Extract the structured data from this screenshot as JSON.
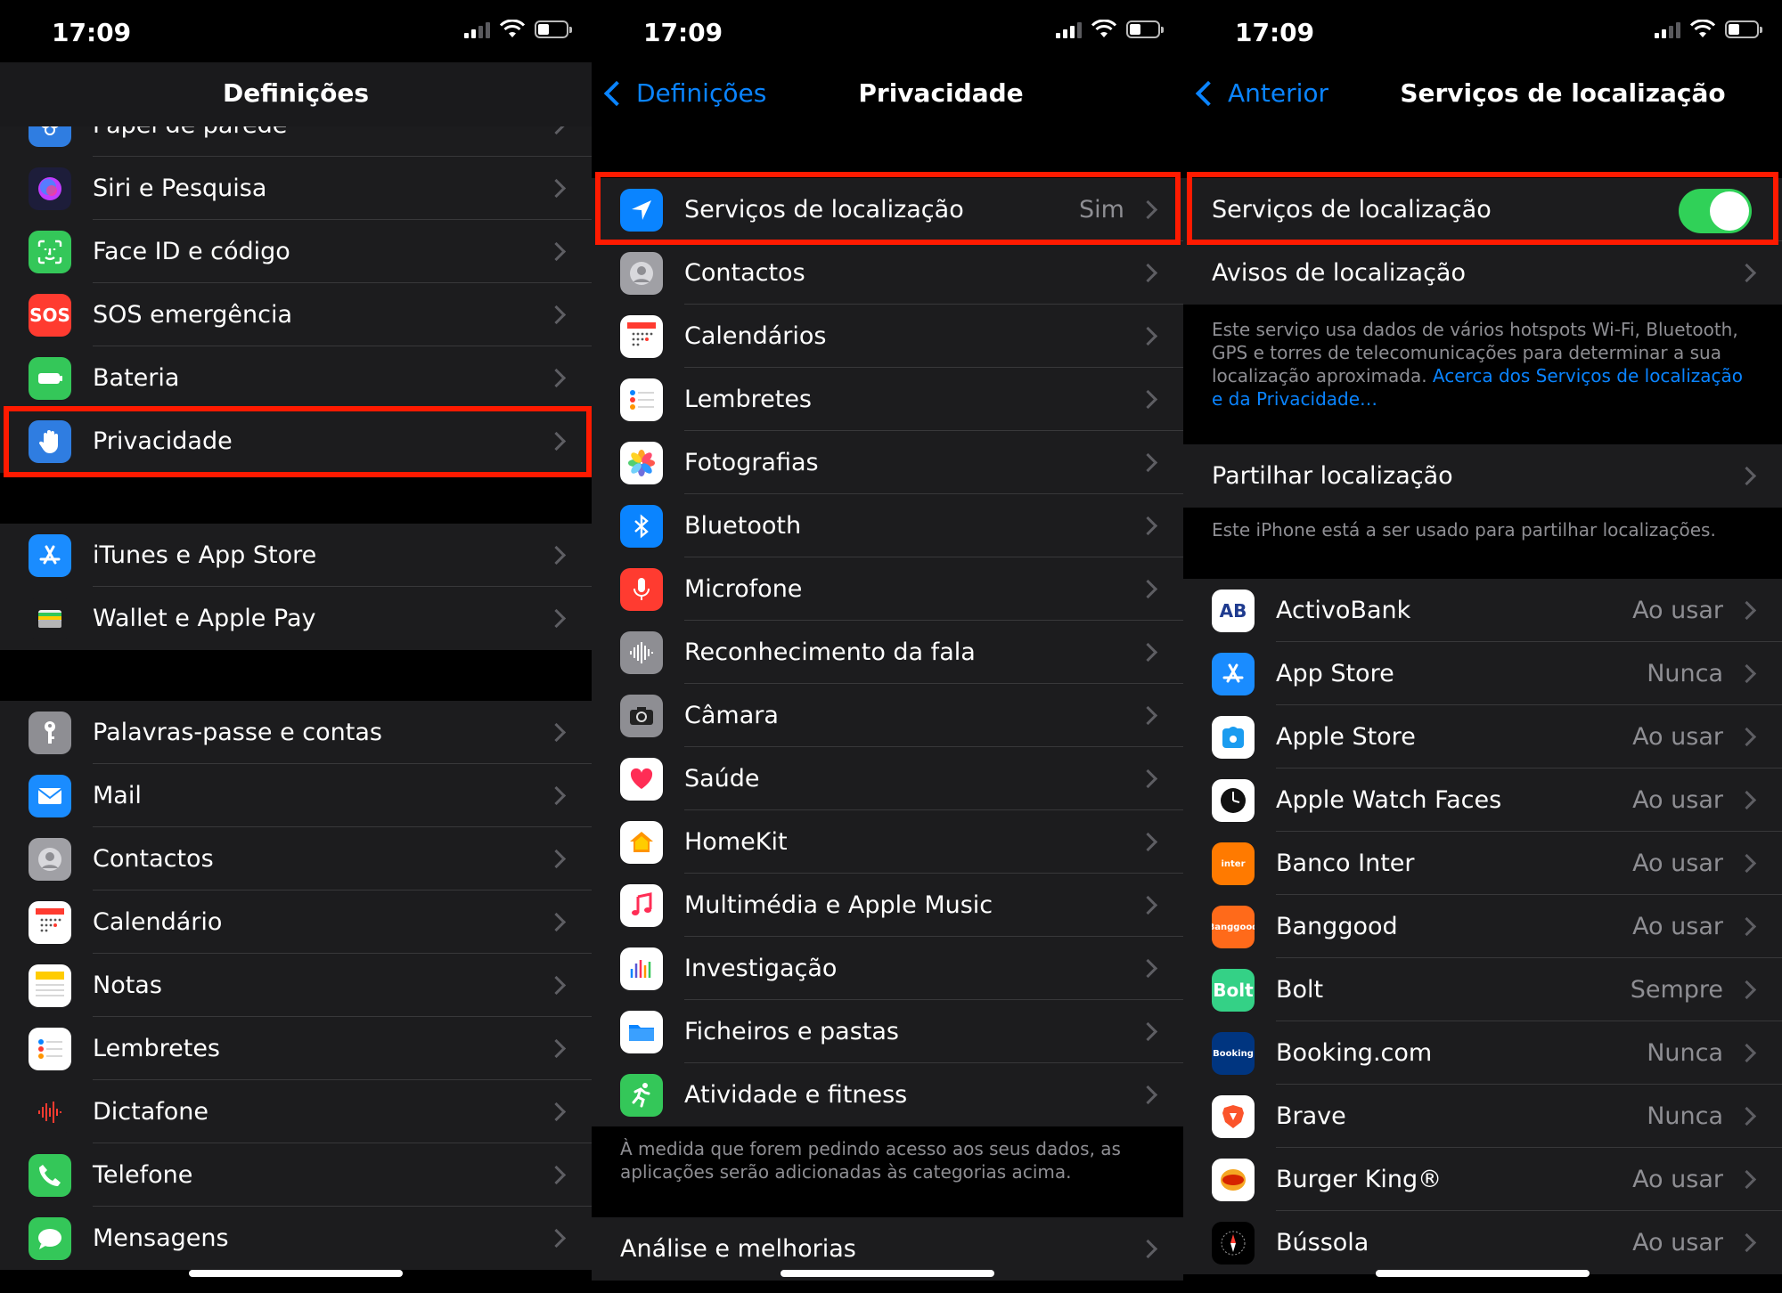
{
  "status": {
    "time": "17:09"
  },
  "colors": {
    "accent": "#0a84ff",
    "highlight": "#ff1a00",
    "toggle_on": "#30d158"
  },
  "screen1": {
    "title": "Definições",
    "group1": [
      {
        "label": "Papel de parede",
        "icon": "wallpaper-icon",
        "color": "#2f7de1"
      },
      {
        "label": "Siri e Pesquisa",
        "icon": "siri-icon",
        "color": "#1d1d3a"
      },
      {
        "label": "Face ID e código",
        "icon": "faceid-icon",
        "color": "#34c759"
      },
      {
        "label": "SOS emergência",
        "icon": "sos-icon",
        "color": "#ff3b30",
        "glyph": "SOS"
      },
      {
        "label": "Bateria",
        "icon": "battery-icon",
        "color": "#34c759"
      },
      {
        "label": "Privacidade",
        "icon": "hand-icon",
        "color": "#2f7de1"
      }
    ],
    "group2": [
      {
        "label": "iTunes e App Store",
        "icon": "appstore-icon",
        "color": "#1a8cff"
      },
      {
        "label": "Wallet e Apple Pay",
        "icon": "wallet-icon",
        "color": "#1c1c1e"
      }
    ],
    "group3": [
      {
        "label": "Palavras-passe e contas",
        "icon": "key-icon",
        "color": "#8e8e93"
      },
      {
        "label": "Mail",
        "icon": "mail-icon",
        "color": "#1a8cff"
      },
      {
        "label": "Contactos",
        "icon": "contacts-icon",
        "color": "#a0a0a5"
      },
      {
        "label": "Calendário",
        "icon": "calendar-icon",
        "color": "#ffffff"
      },
      {
        "label": "Notas",
        "icon": "notes-icon",
        "color": "#ffffff"
      },
      {
        "label": "Lembretes",
        "icon": "reminders-icon",
        "color": "#ffffff"
      },
      {
        "label": "Dictafone",
        "icon": "voicememos-icon",
        "color": "#1c1c1e"
      },
      {
        "label": "Telefone",
        "icon": "phone-icon",
        "color": "#34c759"
      },
      {
        "label": "Mensagens",
        "icon": "messages-icon",
        "color": "#34c759"
      }
    ]
  },
  "screen2": {
    "back": "Definições",
    "title": "Privacidade",
    "items": [
      {
        "label": "Serviços de localização",
        "value": "Sim",
        "icon": "location-arrow-icon",
        "color": "#0a84ff"
      },
      {
        "label": "Contactos",
        "value": "",
        "icon": "contacts-icon",
        "color": "#a0a0a5"
      },
      {
        "label": "Calendários",
        "value": "",
        "icon": "calendar-icon",
        "color": "#ffffff"
      },
      {
        "label": "Lembretes",
        "value": "",
        "icon": "reminders-icon",
        "color": "#ffffff"
      },
      {
        "label": "Fotografias",
        "value": "",
        "icon": "photos-icon",
        "color": "#ffffff"
      },
      {
        "label": "Bluetooth",
        "value": "",
        "icon": "bluetooth-icon",
        "color": "#0a84ff"
      },
      {
        "label": "Microfone",
        "value": "",
        "icon": "microphone-icon",
        "color": "#ff3b30"
      },
      {
        "label": "Reconhecimento da fala",
        "value": "",
        "icon": "speech-icon",
        "color": "#8e8e93"
      },
      {
        "label": "Câmara",
        "value": "",
        "icon": "camera-icon",
        "color": "#8e8e93"
      },
      {
        "label": "Saúde",
        "value": "",
        "icon": "health-icon",
        "color": "#ffffff"
      },
      {
        "label": "HomeKit",
        "value": "",
        "icon": "home-icon",
        "color": "#ffffff"
      },
      {
        "label": "Multimédia e Apple Music",
        "value": "",
        "icon": "music-icon",
        "color": "#ffffff"
      },
      {
        "label": "Investigação",
        "value": "",
        "icon": "research-icon",
        "color": "#ffffff"
      },
      {
        "label": "Ficheiros e pastas",
        "value": "",
        "icon": "files-icon",
        "color": "#ffffff"
      },
      {
        "label": "Atividade e fitness",
        "value": "",
        "icon": "fitness-icon",
        "color": "#34c759"
      }
    ],
    "footer": "À medida que forem pedindo acesso aos seus dados, as aplicações serão adicionadas às categorias acima.",
    "last_item": "Análise e melhorias"
  },
  "screen3": {
    "back": "Anterior",
    "title": "Serviços de localização",
    "toggle_label": "Serviços de localização",
    "toggle_on": true,
    "alerts_label": "Avisos de localização",
    "description": "Este serviço usa dados de vários hotspots Wi-Fi, Bluetooth, GPS e torres de telecomunicações para determinar a sua localização aproximada.",
    "description_link": "Acerca dos Serviços de localização e da Privacidade…",
    "share_label": "Partilhar localização",
    "share_footer": "Este iPhone está a ser usado para partilhar localizações.",
    "apps": [
      {
        "label": "ActivoBank",
        "value": "Ao usar",
        "icon": "activobank-icon",
        "color": "#ffffff",
        "glyph": "AB"
      },
      {
        "label": "App Store",
        "value": "Nunca",
        "icon": "appstore-icon",
        "color": "#1a8cff"
      },
      {
        "label": "Apple Store",
        "value": "Ao usar",
        "icon": "applestore-icon",
        "color": "#ffffff"
      },
      {
        "label": "Apple Watch Faces",
        "value": "Ao usar",
        "icon": "watchface-icon",
        "color": "#ffffff"
      },
      {
        "label": "Banco Inter",
        "value": "Ao usar",
        "icon": "bancointer-icon",
        "color": "#ff7a00",
        "glyph": "inter"
      },
      {
        "label": "Banggood",
        "value": "Ao usar",
        "icon": "banggood-icon",
        "color": "#ff6a1a",
        "glyph": "Banggood"
      },
      {
        "label": "Bolt",
        "value": "Sempre",
        "icon": "bolt-icon",
        "color": "#34d186",
        "glyph": "Bolt"
      },
      {
        "label": "Booking.com",
        "value": "Nunca",
        "icon": "booking-icon",
        "color": "#003580",
        "glyph": "Booking"
      },
      {
        "label": "Brave",
        "value": "Nunca",
        "icon": "brave-icon",
        "color": "#ffffff"
      },
      {
        "label": "Burger King®",
        "value": "Ao usar",
        "icon": "burgerking-icon",
        "color": "#ffffff"
      },
      {
        "label": "Bússola",
        "value": "Ao usar",
        "icon": "compass-icon",
        "color": "#000000"
      }
    ]
  }
}
